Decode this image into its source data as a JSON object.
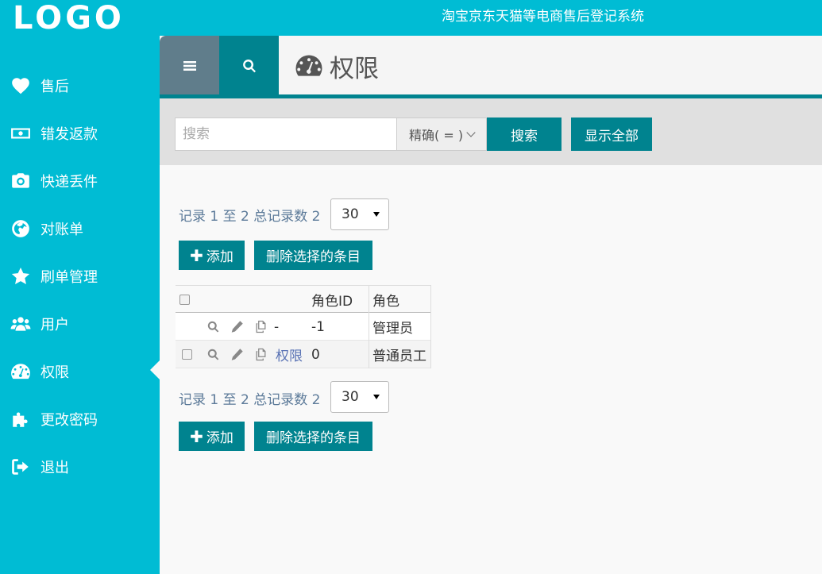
{
  "header": {
    "logo": "LOGO",
    "site_title": "淘宝京东天猫等电商售后登记系统"
  },
  "sidebar": {
    "items": [
      {
        "label": "售后",
        "icon": "heart-icon"
      },
      {
        "label": "错发返款",
        "icon": "money-icon"
      },
      {
        "label": "快递丢件",
        "icon": "camera-icon"
      },
      {
        "label": "对账单",
        "icon": "globe-icon"
      },
      {
        "label": "刷单管理",
        "icon": "star-icon"
      },
      {
        "label": "用户",
        "icon": "users-icon"
      },
      {
        "label": "权限",
        "icon": "dashboard-icon",
        "active": true
      },
      {
        "label": "更改密码",
        "icon": "puzzle-icon"
      },
      {
        "label": "退出",
        "icon": "sign-out-icon"
      }
    ]
  },
  "page": {
    "title": "权限",
    "title_icon": "dashboard-icon"
  },
  "search": {
    "placeholder": "搜索",
    "value": "",
    "match_mode": "精确( = )",
    "search_label": "搜索",
    "show_all_label": "显示全部"
  },
  "records": {
    "summary_top": "记录 1 至 2 总记录数 2",
    "summary_bottom": "记录 1 至 2 总记录数 2",
    "page_size": "30",
    "add_label": "添加",
    "delete_label": "删除选择的条目"
  },
  "table": {
    "columns": [
      "角色ID",
      "角色"
    ],
    "rows": [
      {
        "name": "-",
        "id": "-1",
        "role": "管理员",
        "selectable": false
      },
      {
        "name": "权限",
        "id": "0",
        "role": "普通员工",
        "selectable": true
      }
    ]
  },
  "colors": {
    "primary": "#00bcd4",
    "accent": "#00838f",
    "menu_tab": "#607d8b"
  }
}
